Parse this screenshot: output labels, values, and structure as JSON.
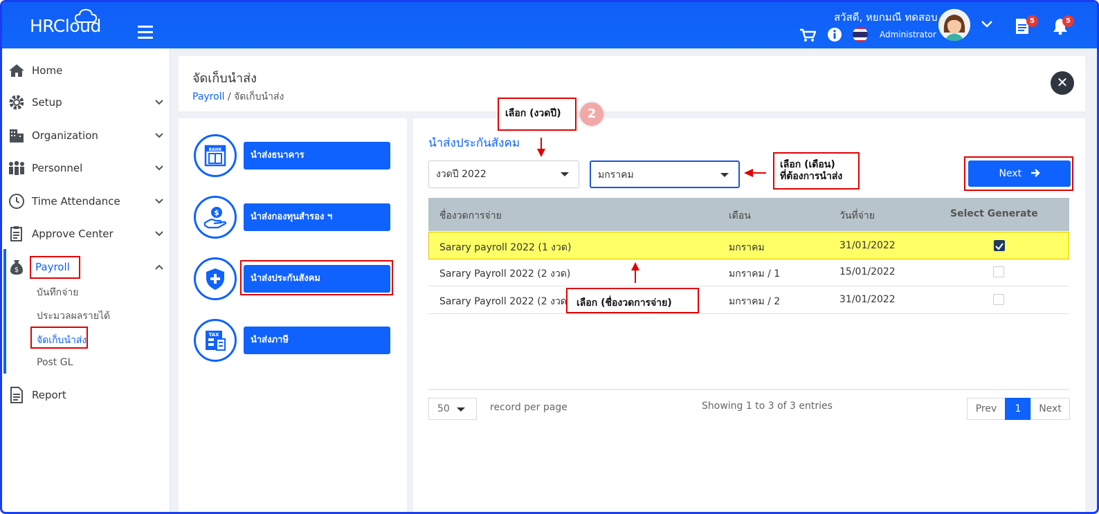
{
  "app": {
    "logo": "HRCloud"
  },
  "user": {
    "greeting": "สวัสดี, หยกมณี ทดสอบ",
    "role": "Administrator",
    "doc_badge": "5",
    "notif_badge": "5"
  },
  "sidebar": {
    "items": [
      {
        "label": "Home",
        "icon": "home-icon"
      },
      {
        "label": "Setup",
        "icon": "gear-icon"
      },
      {
        "label": "Organization",
        "icon": "building-icon"
      },
      {
        "label": "Personnel",
        "icon": "people-icon"
      },
      {
        "label": "Time Attendance",
        "icon": "clock-icon"
      },
      {
        "label": "Approve Center",
        "icon": "clipboard-icon"
      },
      {
        "label": "Payroll",
        "icon": "money-bag-icon"
      },
      {
        "label": "Report",
        "icon": "document-icon"
      }
    ],
    "payroll_sub": [
      "บันทึกจ่าย",
      "ประมวลผลรายได้",
      "จัดเก็บนำส่ง",
      "Post GL"
    ]
  },
  "header": {
    "title": "จัดเก็บนำส่ง",
    "crumb_root": "Payroll",
    "crumb_current": "/ จัดเก็บนำส่ง"
  },
  "menu": [
    {
      "label": "นำส่งธนาคาร",
      "icon": "bank-icon"
    },
    {
      "label": "นำส่งกองทุนสำรอง ฯ",
      "icon": "fund-icon"
    },
    {
      "label": "นำส่งประกันสังคม",
      "icon": "shield-plus-icon"
    },
    {
      "label": "นำส่งภาษี",
      "icon": "tax-icon"
    }
  ],
  "main": {
    "section_title": "นำส่งประกันสังคม",
    "year_select": "งวดปี 2022",
    "month_select": "มกราคม",
    "next_label": "Next",
    "columns": [
      "ชื่องวดการจ่าย",
      "เดือน",
      "วันที่จ่าย",
      "Select Generate"
    ],
    "rows": [
      {
        "name": "Sarary payroll 2022 (1 งวด)",
        "month": "มกราคม",
        "date": "31/01/2022",
        "checked": true
      },
      {
        "name": "Sarary Payroll 2022 (2 งวด)",
        "month": "มกราคม / 1",
        "date": "15/01/2022",
        "checked": false
      },
      {
        "name": "Sarary Payroll 2022 (2 งวด)",
        "month": "มกราคม / 2",
        "date": "31/01/2022",
        "checked": false
      }
    ],
    "page_size": "50",
    "per_page_label": "record per page",
    "showing": "Showing 1 to 3 of 3 entries",
    "prev": "Prev",
    "page": "1",
    "next_page": "Next"
  },
  "annotations": {
    "step_number": "2",
    "year_note": "เลือก (งวดปี)",
    "month_note_1": "เลือก (เดือน)",
    "month_note_2": "ที่ต้องการนำส่ง",
    "row_note": "เลือก (ชื่องวดการจ่าย)"
  },
  "colors": {
    "primary": "#0f62fe",
    "highlight": "#ffff66",
    "annotation": "#e00000"
  }
}
